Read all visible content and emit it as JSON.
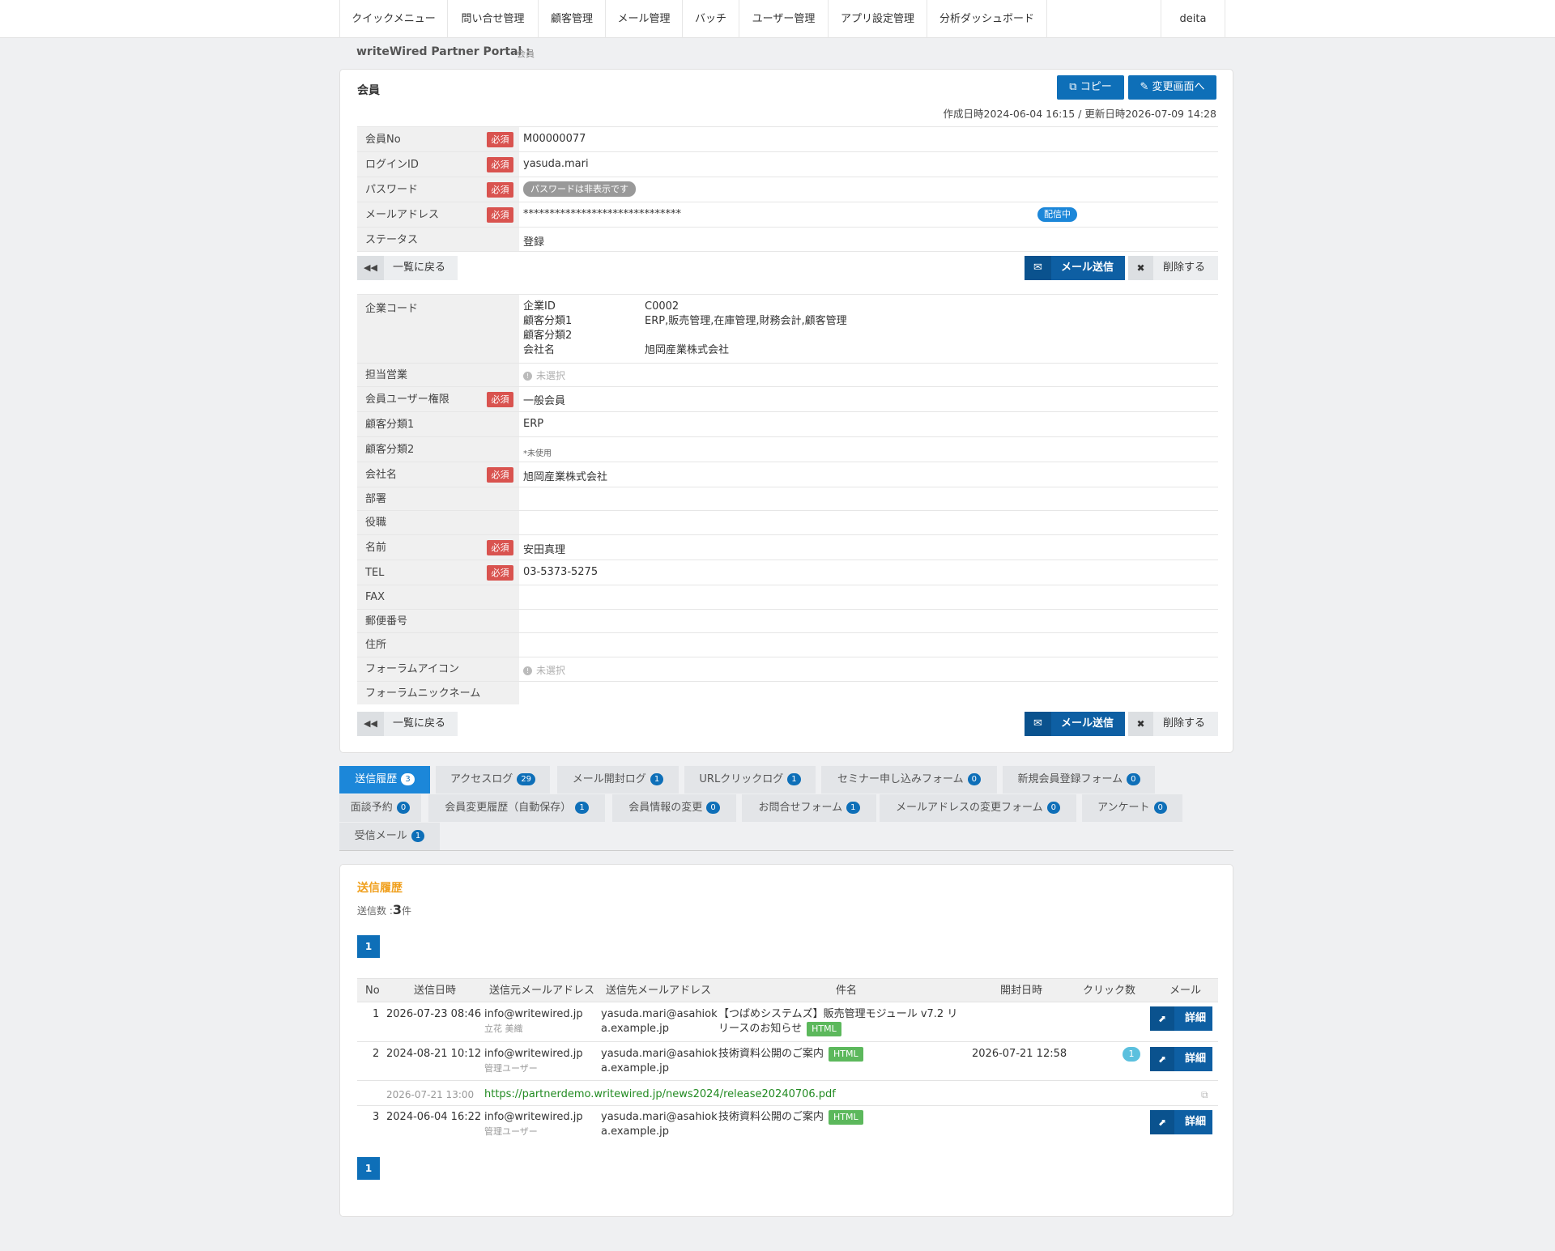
{
  "nav": {
    "items": [
      "クイックメニュー",
      "問い合せ管理",
      "顧客管理",
      "メール管理",
      "バッチ",
      "ユーザー管理",
      "アプリ設定管理",
      "分析ダッシュボード"
    ],
    "user": "deita"
  },
  "breadcrumb": {
    "app": "writeWired Partner Portal :",
    "page": "会員"
  },
  "member": {
    "title": "会員",
    "copy_label": "コピー",
    "edit_label": "変更画面へ",
    "dates": "作成日時2024-06-04 16:15 / 更新日時2026-07-09 14:28",
    "required_label": "必須",
    "fields": {
      "no": {
        "label": "会員No",
        "value": "M00000077"
      },
      "login": {
        "label": "ログインID",
        "value": "yasuda.mari"
      },
      "password": {
        "label": "パスワード",
        "value": "パスワードは非表示です"
      },
      "email": {
        "label": "メールアドレス",
        "value": "******************************",
        "status": "配信中"
      },
      "status": {
        "label": "ステータス",
        "value": "登録"
      }
    },
    "back_label": "一覧に戻る",
    "mail_label": "メール送信",
    "delete_label": "削除する",
    "company_code": {
      "label": "企業コード",
      "rows": [
        {
          "k": "企業ID",
          "v": "C0002"
        },
        {
          "k": "顧客分類1",
          "v": "ERP,販売管理,在庫管理,財務会計,顧客管理"
        },
        {
          "k": "顧客分類2",
          "v": ""
        },
        {
          "k": "会社名",
          "v": "旭岡産業株式会社"
        }
      ]
    },
    "details": {
      "sales": {
        "label": "担当営業",
        "value": "未選択"
      },
      "role": {
        "label": "会員ユーザー権限",
        "value": "一般会員"
      },
      "cat1": {
        "label": "顧客分類1",
        "value": "ERP"
      },
      "cat2": {
        "label": "顧客分類2",
        "value": "*未使用"
      },
      "company": {
        "label": "会社名",
        "value": "旭岡産業株式会社"
      },
      "dept": {
        "label": "部署",
        "value": ""
      },
      "position": {
        "label": "役職",
        "value": ""
      },
      "name": {
        "label": "名前",
        "value": "安田真理"
      },
      "tel": {
        "label": "TEL",
        "value": "03-5373-5275"
      },
      "fax": {
        "label": "FAX",
        "value": ""
      },
      "zip": {
        "label": "郵便番号",
        "value": ""
      },
      "address": {
        "label": "住所",
        "value": ""
      },
      "forum_icon": {
        "label": "フォーラムアイコン",
        "value": "未選択"
      },
      "forum_nick": {
        "label": "フォーラムニックネーム",
        "value": ""
      }
    }
  },
  "tabs": [
    {
      "label": "送信履歴",
      "count": "3"
    },
    {
      "label": "アクセスログ",
      "count": "29"
    },
    {
      "label": "メール開封ログ",
      "count": "1"
    },
    {
      "label": "URLクリックログ",
      "count": "1"
    },
    {
      "label": "セミナー申し込みフォーム",
      "count": "0"
    },
    {
      "label": "新規会員登録フォーム",
      "count": "0"
    },
    {
      "label": "面談予約",
      "count": "0"
    },
    {
      "label": "会員変更履歴（自動保存）",
      "count": "1"
    },
    {
      "label": "会員情報の変更",
      "count": "0"
    },
    {
      "label": "お問合せフォーム",
      "count": "1"
    },
    {
      "label": "メールアドレスの変更フォーム",
      "count": "0"
    },
    {
      "label": "アンケート",
      "count": "0"
    },
    {
      "label": "受信メール",
      "count": "1"
    }
  ],
  "history": {
    "title": "送信履歴",
    "count_prefix": "送信数 :",
    "count": "3",
    "count_suffix": "件",
    "page": "1",
    "columns": [
      "No",
      "送信日時",
      "送信元メールアドレス",
      "送信先メールアドレス",
      "件名",
      "開封日時",
      "クリック数",
      "メール"
    ],
    "detail_label": "詳細",
    "html_badge": "HTML",
    "rows": [
      {
        "no": "1",
        "date": "2026-07-23 08:46",
        "from": "info@writewired.jp",
        "from_sub": "立花 美織",
        "to1": "yasuda.mari@asahiok",
        "to2": "a.example.jp",
        "subj1": "【つばめシステムズ】販売管理モジュール v7.2 リ",
        "subj2": "リースのお知らせ",
        "opened": "",
        "clicks": ""
      },
      {
        "no": "2",
        "date": "2024-08-21 10:12",
        "from": "info@writewired.jp",
        "from_sub": "管理ユーザー",
        "to1": "yasuda.mari@asahiok",
        "to2": "a.example.jp",
        "subj1": "技術資料公開のご案内",
        "subj2": "",
        "opened": "2026-07-21 12:58",
        "clicks": "1"
      },
      {
        "no": "3",
        "date": "2024-06-04 16:22",
        "from": "info@writewired.jp",
        "from_sub": "管理ユーザー",
        "to1": "yasuda.mari@asahiok",
        "to2": "a.example.jp",
        "subj1": "技術資料公開のご案内",
        "subj2": "",
        "opened": "",
        "clicks": ""
      }
    ],
    "click_log": {
      "date": "2026-07-21 13:00",
      "url": "https://partnerdemo.writewired.jp/news2024/release20240706.pdf"
    }
  },
  "colors": {
    "accent": "#0e6fb8",
    "required": "#d9534f",
    "html_badge": "#5cb85c",
    "section_title": "#f0a01e"
  }
}
